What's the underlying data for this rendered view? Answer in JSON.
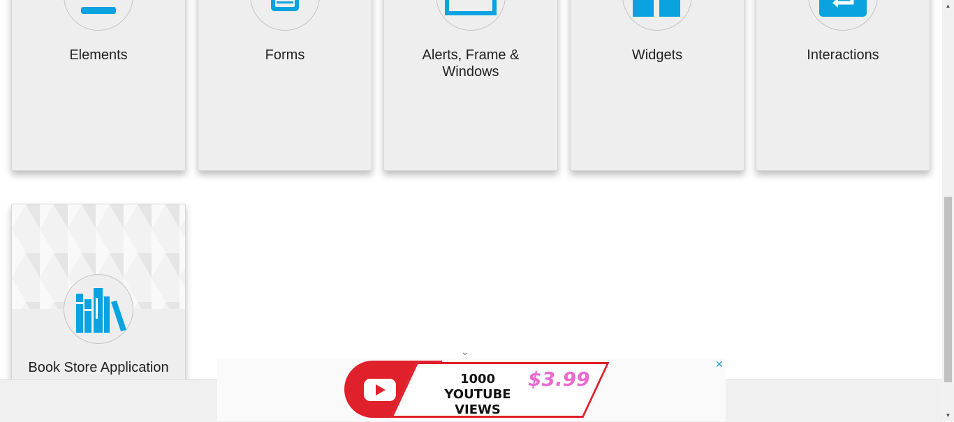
{
  "cards": [
    {
      "title": "Elements",
      "icon": "elements-icon"
    },
    {
      "title": "Forms",
      "icon": "forms-icon"
    },
    {
      "title": "Alerts, Frame & Windows",
      "icon": "alerts-icon"
    },
    {
      "title": "Widgets",
      "icon": "widgets-icon"
    },
    {
      "title": "Interactions",
      "icon": "interactions-icon"
    }
  ],
  "bookstore": {
    "title": "Book Store Application",
    "icon": "books-icon"
  },
  "ad": {
    "headline": "1000 YOUTUBE VIEWS",
    "price": "$3.99",
    "close_label": "✕",
    "collapse_label": "⌄"
  },
  "colors": {
    "accent": "#0aa3e0",
    "ad_red": "#e0202a",
    "ad_price": "#e96ad0"
  }
}
